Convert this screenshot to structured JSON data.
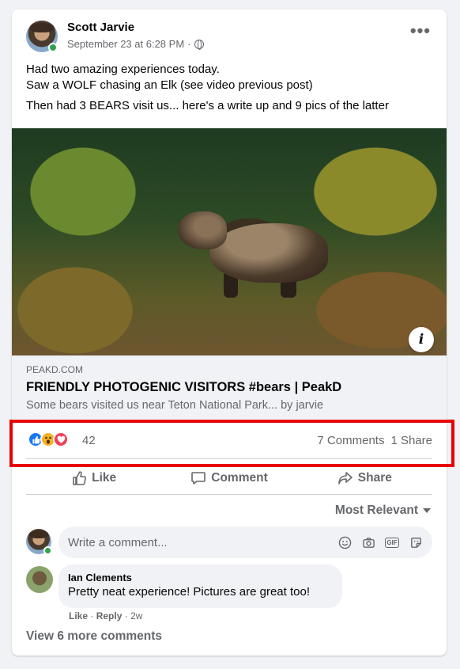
{
  "post": {
    "author": "Scott Jarvie",
    "timestamp": "September 23 at 6:28 PM",
    "separator": "·",
    "privacy_icon": "globe-icon",
    "more_icon": "•••",
    "text_line1": "Had two amazing experiences today.",
    "text_line2": "Saw a WOLF chasing an Elk (see video previous post)",
    "text_line3": "Then had 3 BEARS visit us... here's a write up and 9 pics of the latter"
  },
  "link_preview": {
    "info_icon": "i",
    "domain": "PEAKD.COM",
    "title": "FRIENDLY PHOTOGENIC VISITORS #bears | PeakD",
    "description": "Some bears visited us near Teton National Park... by jarvie"
  },
  "reactions": {
    "types": [
      "like",
      "wow",
      "love"
    ],
    "count": "42",
    "comments": "7 Comments",
    "shares": "1 Share"
  },
  "actions": {
    "like": "Like",
    "comment": "Comment",
    "share": "Share"
  },
  "comments_section": {
    "sort_label": "Most Relevant",
    "input_placeholder": "Write a comment...",
    "comment": {
      "author": "Ian Clements",
      "text": "Pretty neat experience! Pictures are great too!",
      "like": "Like",
      "reply": "Reply",
      "age": "2w"
    },
    "view_more": "View 6 more comments"
  },
  "colors": {
    "accent": "#1877f2",
    "highlight": "#e80000",
    "muted_text": "#65676b"
  }
}
